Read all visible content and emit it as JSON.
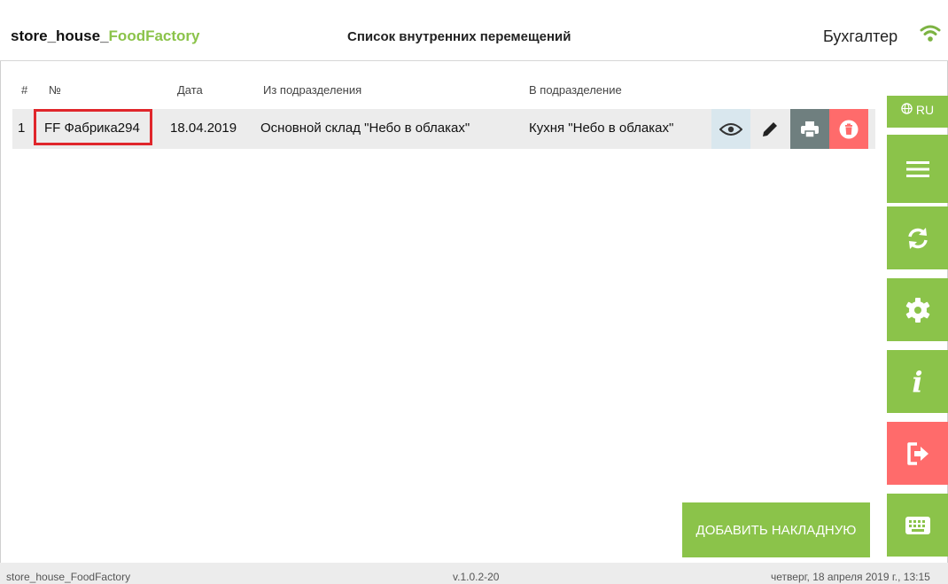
{
  "header": {
    "app_title_prefix": "store_house_",
    "app_title_accent": "FoodFactory",
    "page_title": "Список внутренних перемещений",
    "role": "Бухгалтер",
    "wifi_icon": "wifi-icon"
  },
  "table": {
    "columns": [
      "#",
      "№",
      "Дата",
      "Из подразделения",
      "В подразделение"
    ],
    "rows": [
      {
        "index": "1",
        "number": "FF Фабрика294",
        "date": "18.04.2019",
        "from": "Основной склад \"Небо в облаках\"",
        "to": "Кухня \"Небо в облаках\"",
        "actions": [
          "eye-icon",
          "pencil-icon",
          "printer-icon",
          "trash-icon"
        ]
      }
    ]
  },
  "sidebar": {
    "language": "RU",
    "buttons": [
      "menu-icon",
      "sync-icon",
      "gear-icon",
      "info-icon",
      "logout-icon",
      "keyboard-icon"
    ],
    "info_glyph": "i"
  },
  "add_button_label": "ДОБАВИТЬ НАКЛАДНУЮ",
  "footer": {
    "app_name": "store_house_FoodFactory",
    "version": "v.1.0.2-20",
    "datetime": "четверг, 18 апреля 2019 г., 13:15"
  },
  "colors": {
    "accent": "#8bc34a",
    "danger": "#ff6b6b",
    "highlight": "#e0262b",
    "print": "#6f7f7f"
  }
}
